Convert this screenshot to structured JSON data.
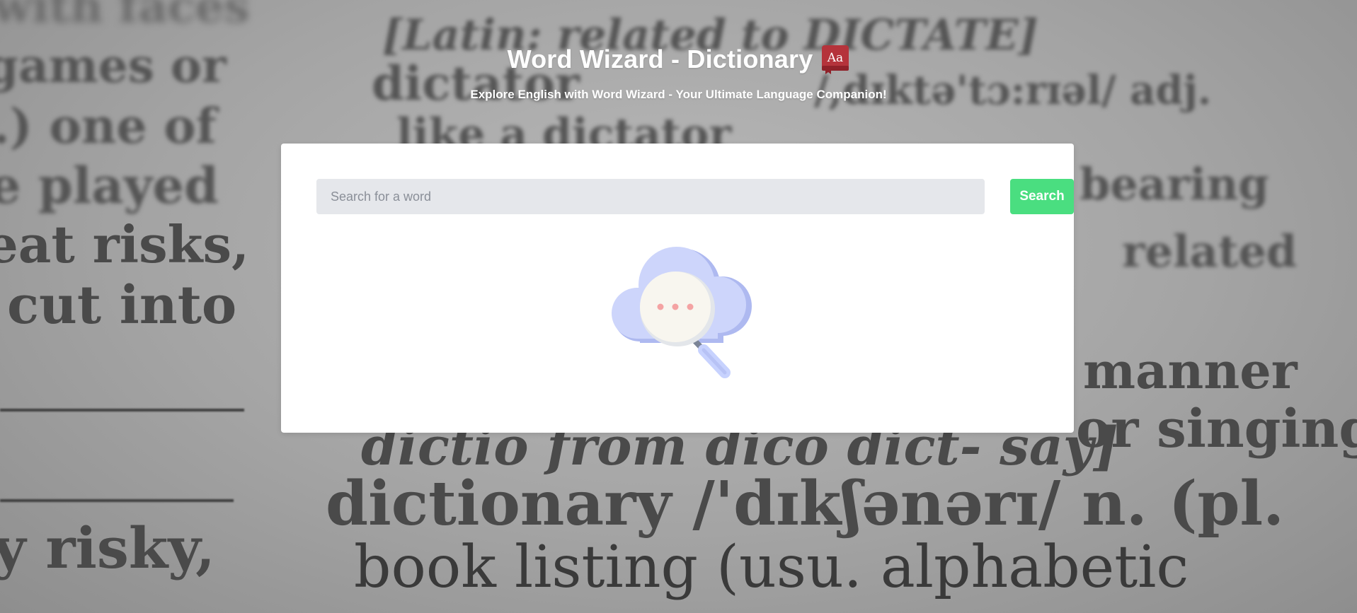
{
  "header": {
    "title": "Word Wizard - Dictionary",
    "book_icon_text": "Aa",
    "subtitle": "Explore English with Word Wizard - Your Ultimate Language Companion!"
  },
  "search": {
    "placeholder": "Search for a word",
    "value": "",
    "button_label": "Search"
  },
  "illustration": {
    "icon": "cloud-search-icon"
  },
  "background": {
    "lines": [
      "with faces",
      "games or",
      ".) one of",
      "e played",
      "eat risks,",
      "cut into",
      "y risky,",
      "[Latin: related to DICTATE]",
      "dictator",
      "/,dɪktə'tɔ:rɪəl/ adj.",
      "like a dictator",
      "bearing",
      "related",
      "manner",
      "or singing",
      "dictio from dico dict- say]",
      "dictionary /'dɪkʃənərɪ/ n. (pl.",
      "book listing (usu. alphabetic"
    ]
  },
  "colors": {
    "search_button": "#4ade80",
    "search_input_bg": "#e5e7eb",
    "card_bg": "#ffffff",
    "book_icon": "#b5333b",
    "cloud": "#c7d2fe",
    "dots": "#f4a3a3"
  }
}
